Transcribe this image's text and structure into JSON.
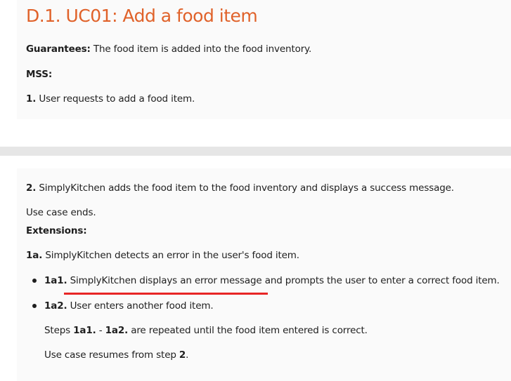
{
  "title": "D.1. UC01: Add a food item",
  "guarantees": {
    "label": "Guarantees:",
    "text": " The food item is added into the food inventory."
  },
  "mss_label": "MSS:",
  "steps": [
    {
      "num": "1.",
      "text": " User requests to add a food item."
    },
    {
      "num": "2.",
      "text": " SimplyKitchen adds the food item to the food inventory and displays a success message."
    }
  ],
  "use_case_ends": "Use case ends.",
  "extensions_label": "Extensions:",
  "extension": {
    "num": "1a.",
    "text": " SimplyKitchen detects an error in the user's food item.",
    "sub_items": [
      {
        "num": "1a1.",
        "text": " SimplyKitchen displays an error message and prompts the user to enter a correct food item."
      },
      {
        "num": "1a2.",
        "text": " User enters another food item."
      }
    ],
    "repeat": {
      "prefix": "Steps ",
      "from": "1a1.",
      "sep": " - ",
      "to": "1a2.",
      "suffix": " are repeated until the food item entered is correct."
    },
    "resume": {
      "prefix": "Use case resumes from step ",
      "step": "2",
      "suffix": "."
    }
  },
  "colors": {
    "heading": "#e0622a",
    "underline": "#e82525",
    "card_bg": "#fafafa",
    "gap_band": "#e6e6e6"
  }
}
